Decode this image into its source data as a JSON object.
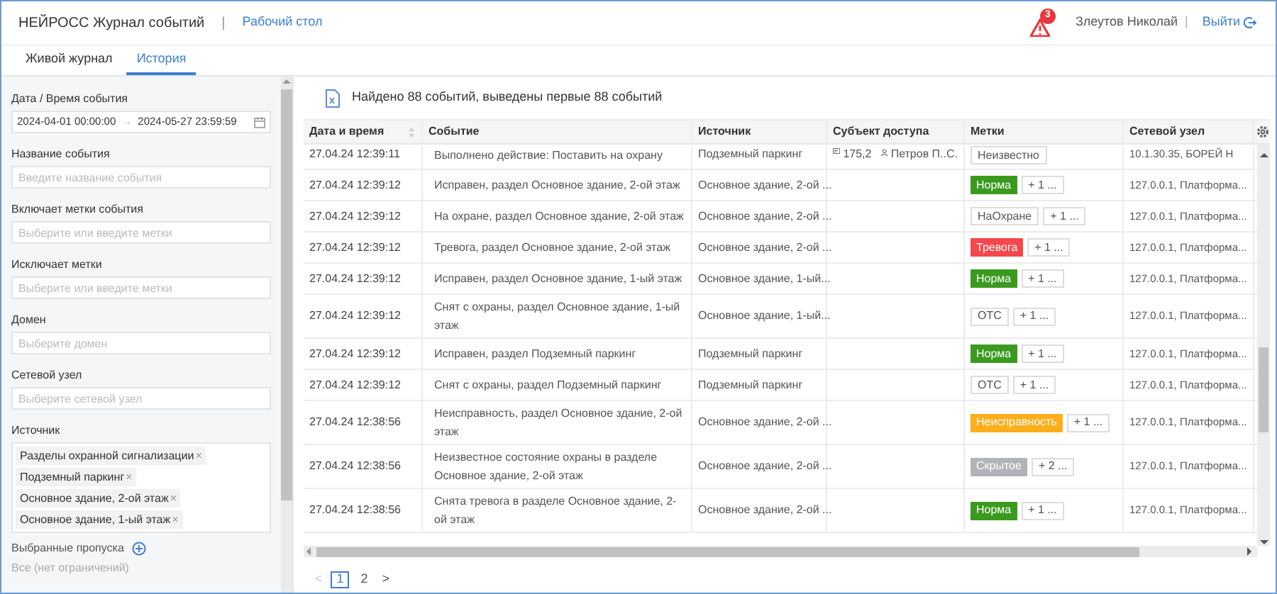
{
  "header": {
    "title": "НЕЙРОСС Журнал событий",
    "separator": "|",
    "link": "Рабочий стол",
    "alarm_count": "3",
    "user": "Злеутов Николай",
    "user_separator": "|",
    "logout": "Выйти"
  },
  "tabs": [
    {
      "label": "Живой журнал",
      "selected": false
    },
    {
      "label": "История",
      "selected": true
    }
  ],
  "filters": {
    "date": {
      "label": "Дата / Время события",
      "from": "2024-04-01 00:00:00",
      "arrow": "→",
      "to": "2024-05-27 23:59:59"
    },
    "fields": [
      {
        "label": "Название события",
        "placeholder": "Введите название события"
      },
      {
        "label": "Включает метки события",
        "placeholder": "Выберите или введите метки"
      },
      {
        "label": "Исключает метки",
        "placeholder": "Выберите или введите метки"
      },
      {
        "label": "Домен",
        "placeholder": "Выберите домен"
      },
      {
        "label": "Сетевой узел",
        "placeholder": "Выберите сетевой узел"
      }
    ],
    "source": {
      "label": "Источник",
      "chips": [
        "Разделы охранной сигнализации",
        "Подземный паркинг",
        "Основное здание, 2-ой этаж",
        "Основное здание, 1-ый этаж"
      ],
      "chip_remove": "×"
    },
    "passes": {
      "label": "Выбранные пропуска",
      "value": "Все (нет ограничений)"
    }
  },
  "summary": "Найдено 88 событий, выведены первые 88 событий",
  "table": {
    "columns": [
      "Дата и время",
      "Событие",
      "Источник",
      "Субъект доступа",
      "Метки",
      "Сетевой узел"
    ],
    "rows": [
      {
        "date": "27.04.24 12:39:11",
        "event": "Выполнено действие: Поставить на охрану",
        "source": "Подземный паркинг",
        "subject": {
          "card": "175,2",
          "person": "Петров П..С."
        },
        "tags": [
          {
            "text": "Неизвестно",
            "kind": "outline"
          }
        ],
        "node": "10.1.30.35, БОРЕЙ Н"
      },
      {
        "date": "27.04.24 12:39:12",
        "event": "Исправен, раздел Основное здание, 2-ой этаж",
        "source": "Основное здание, 2-ой ...",
        "tags": [
          {
            "text": "Норма",
            "kind": "filled",
            "color": "#3a9a1e"
          },
          {
            "text": "+ 1 ...",
            "kind": "outline"
          }
        ],
        "node": "127.0.0.1, Платформа..."
      },
      {
        "date": "27.04.24 12:39:12",
        "event": "На охране, раздел Основное здание, 2-ой этаж",
        "source": "Основное здание, 2-ой ...",
        "tags": [
          {
            "text": "НаОхране",
            "kind": "outline"
          },
          {
            "text": "+ 1 ...",
            "kind": "outline"
          }
        ],
        "node": "127.0.0.1, Платформа..."
      },
      {
        "date": "27.04.24 12:39:12",
        "event": "Тревога, раздел Основное здание, 2-ой этаж",
        "source": "Основное здание, 2-ой ...",
        "tags": [
          {
            "text": "Тревога",
            "kind": "filled",
            "color": "#f5474c"
          },
          {
            "text": "+ 1 ...",
            "kind": "outline"
          }
        ],
        "node": "127.0.0.1, Платформа..."
      },
      {
        "date": "27.04.24 12:39:12",
        "event": "Исправен, раздел Основное здание, 1-ый этаж",
        "source": "Основное здание, 1-ый...",
        "tags": [
          {
            "text": "Норма",
            "kind": "filled",
            "color": "#3a9a1e"
          },
          {
            "text": "+ 1 ...",
            "kind": "outline"
          }
        ],
        "node": "127.0.0.1, Платформа..."
      },
      {
        "date": "27.04.24 12:39:12",
        "event": "Снят с охраны, раздел Основное здание, 1-ый этаж",
        "source": "Основное здание, 1-ый...",
        "tags": [
          {
            "text": "ОТС",
            "kind": "outline"
          },
          {
            "text": "+ 1 ...",
            "kind": "outline"
          }
        ],
        "node": "127.0.0.1, Платформа..."
      },
      {
        "date": "27.04.24 12:39:12",
        "event": "Исправен, раздел Подземный паркинг",
        "source": "Подземный паркинг",
        "tags": [
          {
            "text": "Норма",
            "kind": "filled",
            "color": "#3a9a1e"
          },
          {
            "text": "+ 1 ...",
            "kind": "outline"
          }
        ],
        "node": "127.0.0.1, Платформа..."
      },
      {
        "date": "27.04.24 12:39:12",
        "event": "Снят с охраны, раздел Подземный паркинг",
        "source": "Подземный паркинг",
        "tags": [
          {
            "text": "ОТС",
            "kind": "outline"
          },
          {
            "text": "+ 1 ...",
            "kind": "outline"
          }
        ],
        "node": "127.0.0.1, Платформа..."
      },
      {
        "date": "27.04.24 12:38:56",
        "event": "Неисправность, раздел Основное здание, 2-ой этаж",
        "source": "Основное здание, 2-ой ...",
        "tags": [
          {
            "text": "Неисправность",
            "kind": "filled",
            "color": "#fdae1a"
          },
          {
            "text": "+ 1 ...",
            "kind": "outline"
          }
        ],
        "node": "127.0.0.1, Платформа..."
      },
      {
        "date": "27.04.24 12:38:56",
        "event": "Неизвестное состояние охраны в разделе Основное здание, 2-ой этаж",
        "source": "Основное здание, 2-ой ...",
        "tags": [
          {
            "text": "Скрытое",
            "kind": "filled",
            "color": "#b0b3b8"
          },
          {
            "text": "+ 2 ...",
            "kind": "outline"
          }
        ],
        "node": "127.0.0.1, Платформа..."
      },
      {
        "date": "27.04.24 12:38:56",
        "event": "Снята тревога в разделе Основное здание, 2-ой этаж",
        "source": "Основное здание, 2-ой ...",
        "tags": [
          {
            "text": "Норма",
            "kind": "filled",
            "color": "#3a9a1e"
          },
          {
            "text": "+ 1 ...",
            "kind": "outline"
          }
        ],
        "node": "127.0.0.1, Платформа..."
      }
    ]
  },
  "pagination": {
    "prev": "<",
    "pages": [
      {
        "label": "1",
        "selected": true
      },
      {
        "label": "2",
        "selected": false
      }
    ],
    "next": ">"
  }
}
